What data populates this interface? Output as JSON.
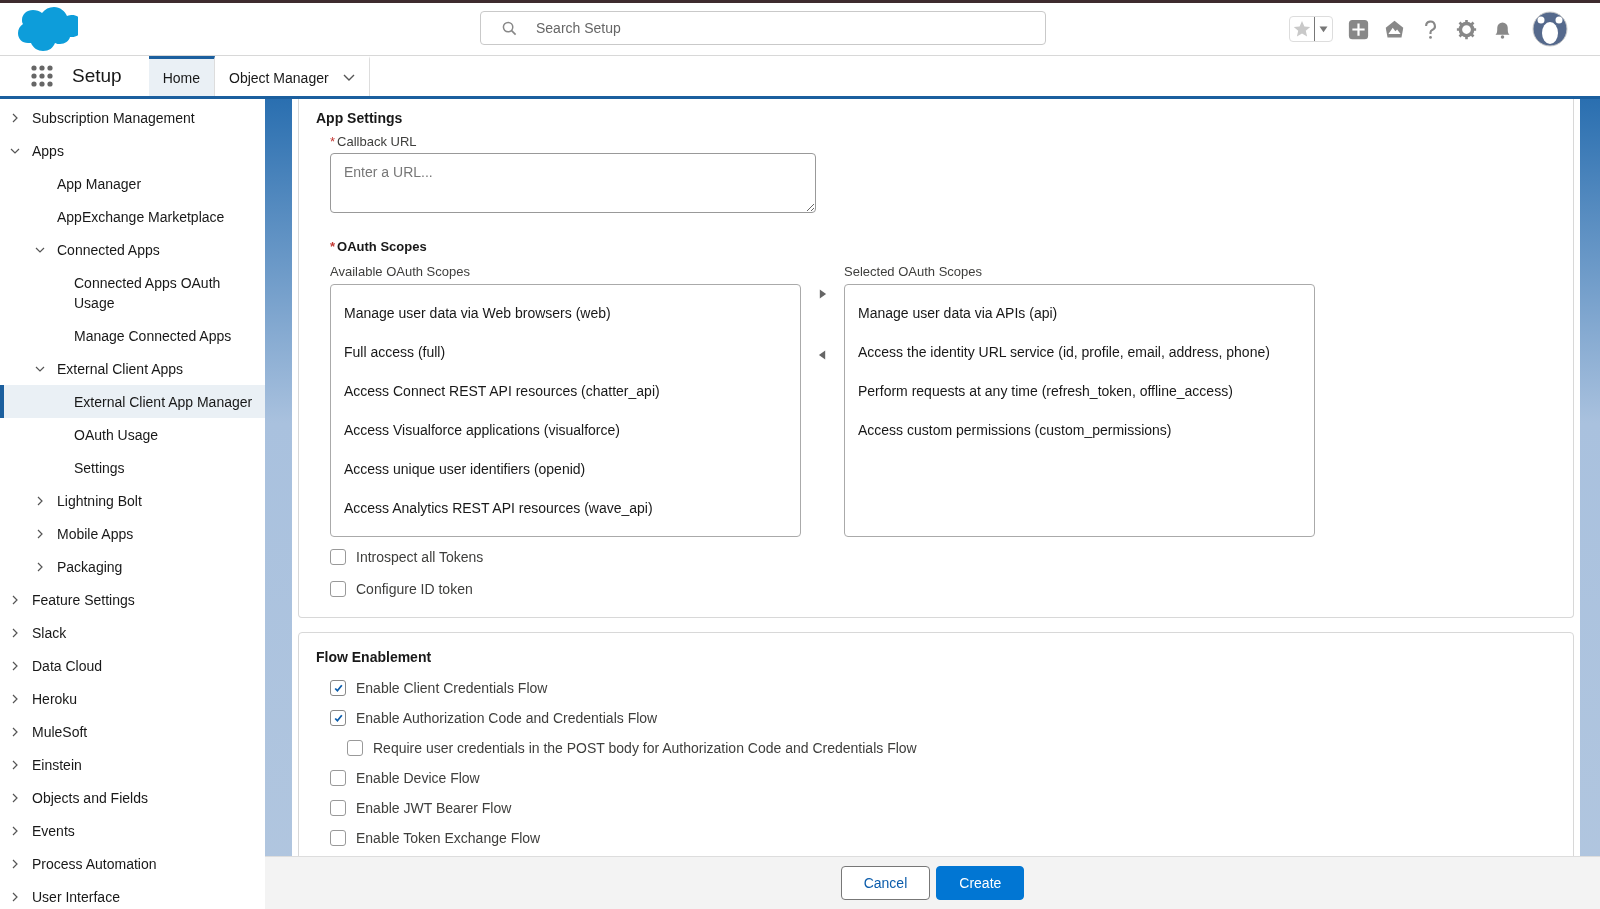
{
  "header": {
    "search": {
      "placeholder": "Search Setup"
    }
  },
  "nav": {
    "app_name": "Setup",
    "tabs": [
      {
        "label": "Home",
        "selected": true,
        "has_menu": false
      },
      {
        "label": "Object Manager",
        "selected": false,
        "has_menu": true
      }
    ]
  },
  "sidebar": {
    "items": [
      {
        "label": "Subscription Management",
        "expanded": false,
        "selected": false
      },
      {
        "label": "Apps",
        "expanded": true,
        "selected": false,
        "children": [
          {
            "label": "App Manager",
            "selected": false
          },
          {
            "label": "AppExchange Marketplace",
            "selected": false
          },
          {
            "label": "Connected Apps",
            "expanded": true,
            "selected": false,
            "children": [
              {
                "label": "Connected Apps OAuth Usage",
                "selected": false
              },
              {
                "label": "Manage Connected Apps",
                "selected": false
              }
            ]
          },
          {
            "label": "External Client Apps",
            "expanded": true,
            "selected": false,
            "children": [
              {
                "label": "External Client App Manager",
                "selected": true
              },
              {
                "label": "OAuth Usage",
                "selected": false
              },
              {
                "label": "Settings",
                "selected": false
              }
            ]
          },
          {
            "label": "Lightning Bolt",
            "expanded": false,
            "selected": false
          },
          {
            "label": "Mobile Apps",
            "expanded": false,
            "selected": false
          },
          {
            "label": "Packaging",
            "expanded": false,
            "selected": false
          }
        ]
      },
      {
        "label": "Feature Settings",
        "expanded": false,
        "selected": false
      },
      {
        "label": "Slack",
        "expanded": false,
        "selected": false
      },
      {
        "label": "Data Cloud",
        "expanded": false,
        "selected": false
      },
      {
        "label": "Heroku",
        "expanded": false,
        "selected": false
      },
      {
        "label": "MuleSoft",
        "expanded": false,
        "selected": false
      },
      {
        "label": "Einstein",
        "expanded": false,
        "selected": false
      },
      {
        "label": "Objects and Fields",
        "expanded": false,
        "selected": false
      },
      {
        "label": "Events",
        "expanded": false,
        "selected": false
      },
      {
        "label": "Process Automation",
        "expanded": false,
        "selected": false
      },
      {
        "label": "User Interface",
        "expanded": false,
        "selected": false
      }
    ]
  },
  "app_settings": {
    "title": "App Settings",
    "callback_url": {
      "label": "Callback URL",
      "required_mark": "*",
      "placeholder": "Enter a URL..."
    },
    "oauth_scopes": {
      "label": "OAuth Scopes",
      "required_mark": "*",
      "available": {
        "label": "Available OAuth Scopes",
        "items": [
          "Manage user data via Web browsers (web)",
          "Full access (full)",
          "Access Connect REST API resources (chatter_api)",
          "Access Visualforce applications (visualforce)",
          "Access unique user identifiers (openid)",
          "Access Analytics REST API resources (wave_api)"
        ]
      },
      "selected": {
        "label": "Selected OAuth Scopes",
        "items": [
          "Manage user data via APIs (api)",
          "Access the identity URL service (id, profile, email, address, phone)",
          "Perform requests at any time (refresh_token, offline_access)",
          "Access custom permissions (custom_permissions)"
        ]
      }
    },
    "options": [
      {
        "label": "Introspect all Tokens",
        "checked": false
      },
      {
        "label": "Configure ID token",
        "checked": false
      }
    ]
  },
  "flow_enablement": {
    "title": "Flow Enablement",
    "options": [
      {
        "label": "Enable Client Credentials Flow",
        "checked": true
      },
      {
        "label": "Enable Authorization Code and Credentials Flow",
        "checked": true,
        "children": [
          {
            "label": "Require user credentials in the POST body for Authorization Code and Credentials Flow",
            "checked": false
          }
        ]
      },
      {
        "label": "Enable Device Flow",
        "checked": false
      },
      {
        "label": "Enable JWT Bearer Flow",
        "checked": false
      },
      {
        "label": "Enable Token Exchange Flow",
        "checked": false
      }
    ]
  },
  "footer": {
    "buttons": [
      {
        "label": "Cancel",
        "kind": "neutral"
      },
      {
        "label": "Create",
        "kind": "brand"
      }
    ]
  }
}
